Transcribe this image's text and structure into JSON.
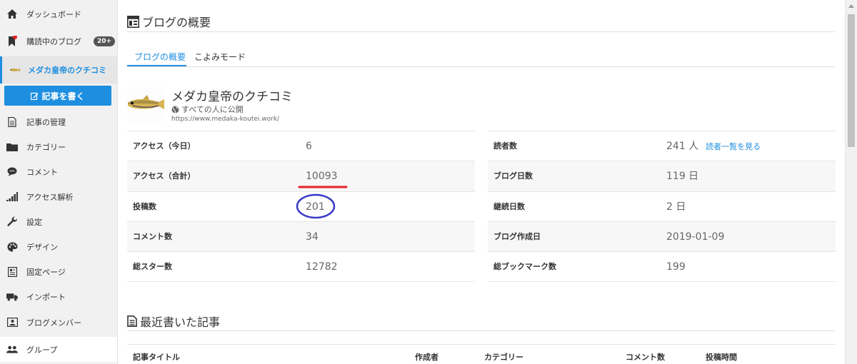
{
  "sidebar": {
    "items": [
      {
        "label": "ダッシュボード",
        "icon": "home-icon"
      },
      {
        "label": "購読中のブログ",
        "icon": "bookmark-icon",
        "badge": "20+"
      },
      {
        "label": "メダカ皇帝のクチコミ",
        "icon": "fish-icon"
      },
      {
        "label": "記事の管理",
        "icon": "document-icon"
      },
      {
        "label": "カテゴリー",
        "icon": "folder-icon"
      },
      {
        "label": "コメント",
        "icon": "comment-icon"
      },
      {
        "label": "アクセス解析",
        "icon": "signal-bars-icon"
      },
      {
        "label": "設定",
        "icon": "wrench-icon"
      },
      {
        "label": "デザイン",
        "icon": "palette-icon"
      },
      {
        "label": "固定ページ",
        "icon": "page-icon"
      },
      {
        "label": "インポート",
        "icon": "truck-icon"
      },
      {
        "label": "ブログメンバー",
        "icon": "id-card-icon"
      },
      {
        "label": "グループ",
        "icon": "group-icon"
      }
    ],
    "write_button": "記事を書く"
  },
  "overview": {
    "title": "ブログの概要",
    "tabs": [
      {
        "label": "ブログの概要",
        "active": true
      },
      {
        "label": "こよみモード",
        "active": false
      }
    ]
  },
  "blog": {
    "name": "メダカ皇帝のクチコミ",
    "visibility": "すべての人に公開",
    "url": "https://www.medaka-koutei.work/"
  },
  "stats_left": [
    {
      "label": "アクセス（今日）",
      "value": "6"
    },
    {
      "label": "アクセス（合計）",
      "value": "10093"
    },
    {
      "label": "投稿数",
      "value": "201"
    },
    {
      "label": "コメント数",
      "value": "34"
    },
    {
      "label": "総スター数",
      "value": "12782"
    }
  ],
  "stats_right": [
    {
      "label": "読者数",
      "value": "241 人",
      "link": "読者一覧を見る"
    },
    {
      "label": "ブログ日数",
      "value": "119 日"
    },
    {
      "label": "継続日数",
      "value": "2 日"
    },
    {
      "label": "ブログ作成日",
      "value": "2019-01-09"
    },
    {
      "label": "総ブックマーク数",
      "value": "199"
    }
  ],
  "recent": {
    "title": "最近書いた記事",
    "columns": [
      "記事タイトル",
      "作成者",
      "カテゴリー",
      "コメント数",
      "投稿時間"
    ]
  },
  "colors": {
    "accent": "#1d8ee0",
    "underline_annotation": "#e8202a",
    "circle_annotation": "#3a3ac8",
    "notification_dot": "#e8202a"
  }
}
